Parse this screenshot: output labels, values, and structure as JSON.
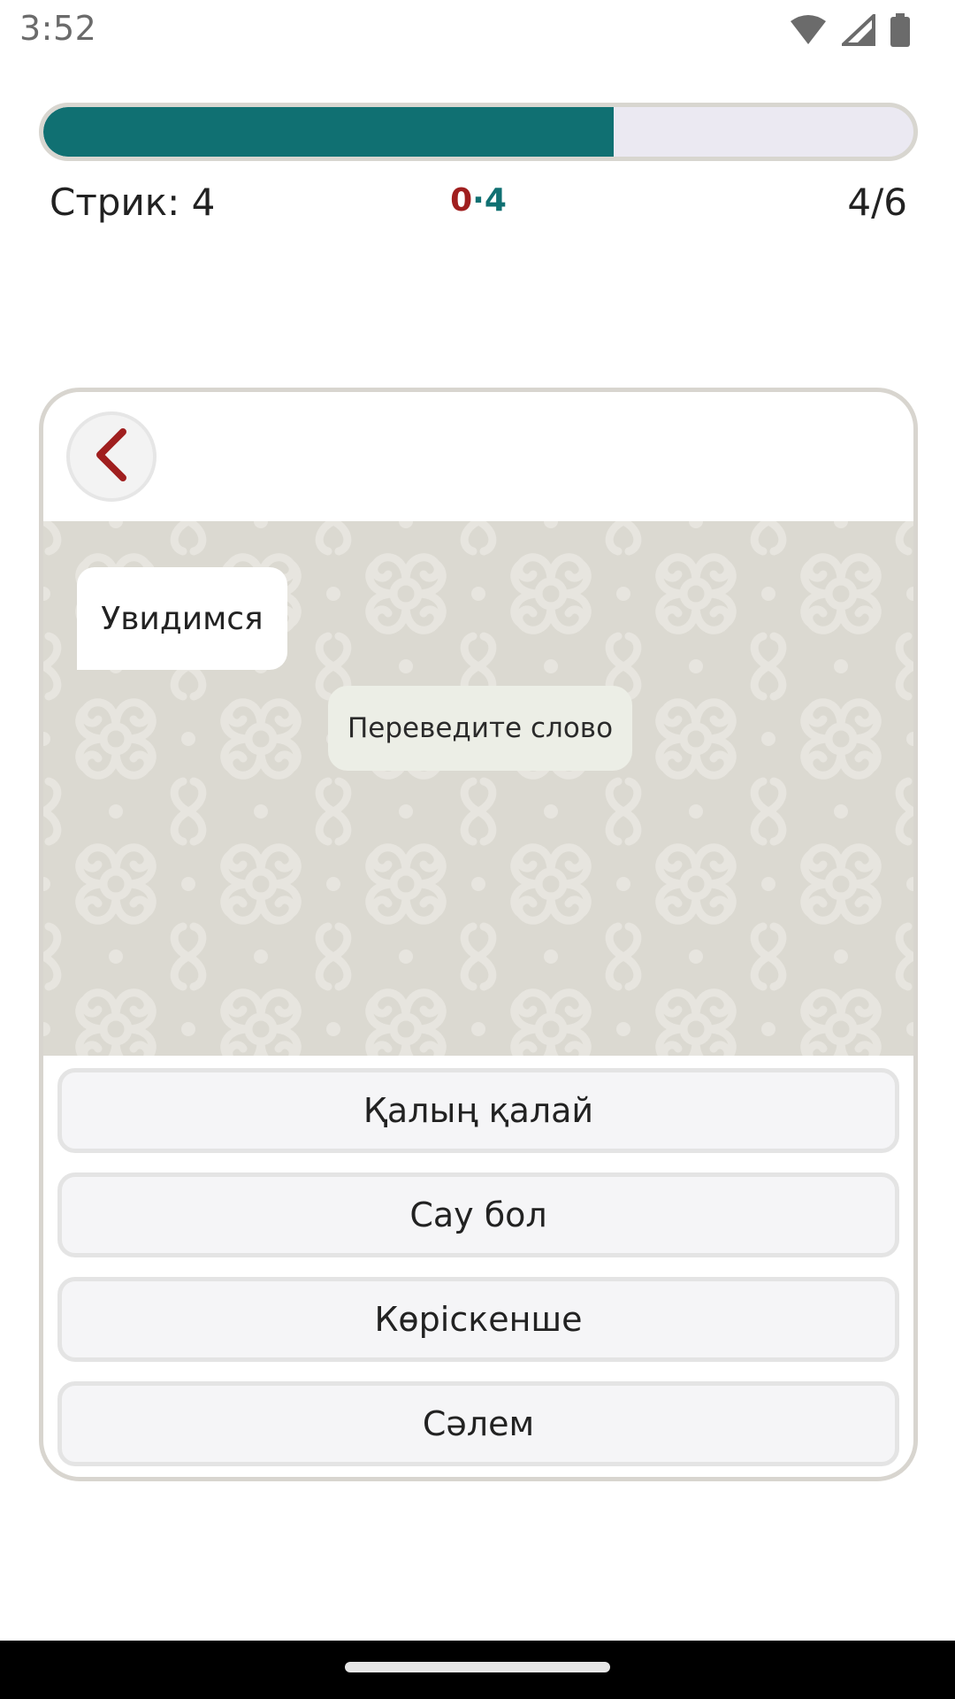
{
  "status_bar": {
    "time": "3:52",
    "icons": [
      "wifi-icon",
      "cellular-signal-icon",
      "battery-icon"
    ]
  },
  "progress": {
    "fraction": 0.655,
    "fill_color": "#107072",
    "track_color": "#ebe9f2"
  },
  "stats": {
    "streak_label": "Стрик: 4",
    "score_wrong": "0",
    "score_separator": "·",
    "score_right": "4",
    "question_counter": "4/6"
  },
  "card": {
    "back_icon": "chevron-left-icon",
    "message": "Увидимся",
    "hint": "Переведите слово",
    "options": [
      {
        "label": "Қалың қалай"
      },
      {
        "label": "Сау бол"
      },
      {
        "label": "Көріскенше"
      },
      {
        "label": "Сәлем"
      }
    ]
  },
  "colors": {
    "accent": "#107072",
    "wrong": "#a01f1f",
    "pattern_background": "#dbd9d1"
  }
}
